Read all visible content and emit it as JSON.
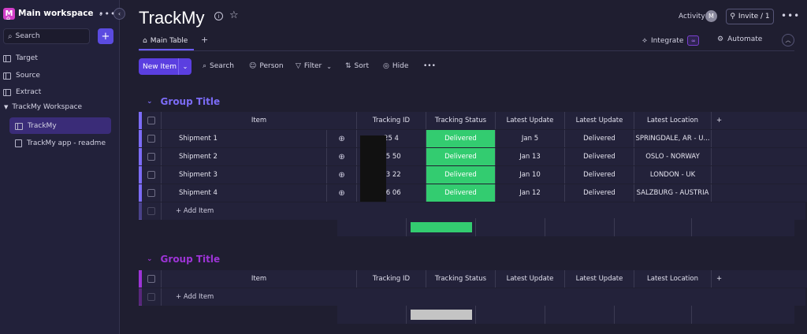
{
  "sidebar": {
    "workspace_initial": "M",
    "workspace_name": "Main workspace",
    "search_placeholder": "Search",
    "items": [
      {
        "label": "Target"
      },
      {
        "label": "Source"
      },
      {
        "label": "Extract"
      }
    ],
    "workspace_section": "TrackMy Workspace",
    "sub_items": [
      {
        "label": "TrackMy"
      },
      {
        "label": "TrackMy app - readme"
      }
    ]
  },
  "header": {
    "title": "TrackMy",
    "activity_label": "Activity",
    "activity_avatar": "M",
    "invite_label": "Invite / 1"
  },
  "tabs": {
    "main_table": "Main Table",
    "add": "+",
    "integrate": "Integrate",
    "automate": "Automate"
  },
  "toolbar": {
    "new_item": "New Item",
    "search": "Search",
    "person": "Person",
    "filter": "Filter",
    "sort": "Sort",
    "hide": "Hide"
  },
  "table_columns": [
    "Item",
    "Tracking ID",
    "Tracking Status",
    "Latest Update",
    "Latest Update",
    "Latest Location"
  ],
  "groups": [
    {
      "title": "Group Title",
      "color": "#7c6cf7",
      "rows": [
        {
          "item": "Shipment 1",
          "tracking_id": "25 4",
          "status": "Delivered",
          "update1": "Jan 5",
          "update2": "Delivered",
          "location": "SPRINGDALE, AR - U..."
        },
        {
          "item": "Shipment 2",
          "tracking_id": "25 50",
          "status": "Delivered",
          "update1": "Jan 13",
          "update2": "Delivered",
          "location": "OSLO - NORWAY"
        },
        {
          "item": "Shipment 3",
          "tracking_id": "73 22",
          "status": "Delivered",
          "update1": "Jan 10",
          "update2": "Delivered",
          "location": "LONDON - UK"
        },
        {
          "item": "Shipment 4",
          "tracking_id": "56 06",
          "status": "Delivered",
          "update1": "Jan 12",
          "update2": "Delivered",
          "location": "SALZBURG - AUSTRIA"
        }
      ],
      "add_item": "+ Add Item"
    },
    {
      "title": "Group Title",
      "color": "#9d34d6",
      "rows": [],
      "add_item": "+ Add Item"
    }
  ],
  "colors": {
    "accent": "#5b3fe0",
    "status_delivered": "#33cc70",
    "status_empty": "#c4c4c4"
  },
  "icons": [
    "home-icon",
    "chevron-down-icon",
    "more-icon",
    "collapse-icon",
    "search-icon",
    "plus-icon",
    "board-icon",
    "doc-icon",
    "info-icon",
    "star-icon",
    "invite-icon",
    "integrate-icon",
    "automate-icon",
    "person-icon",
    "filter-icon",
    "sort-icon",
    "hide-icon",
    "conversation-icon"
  ]
}
